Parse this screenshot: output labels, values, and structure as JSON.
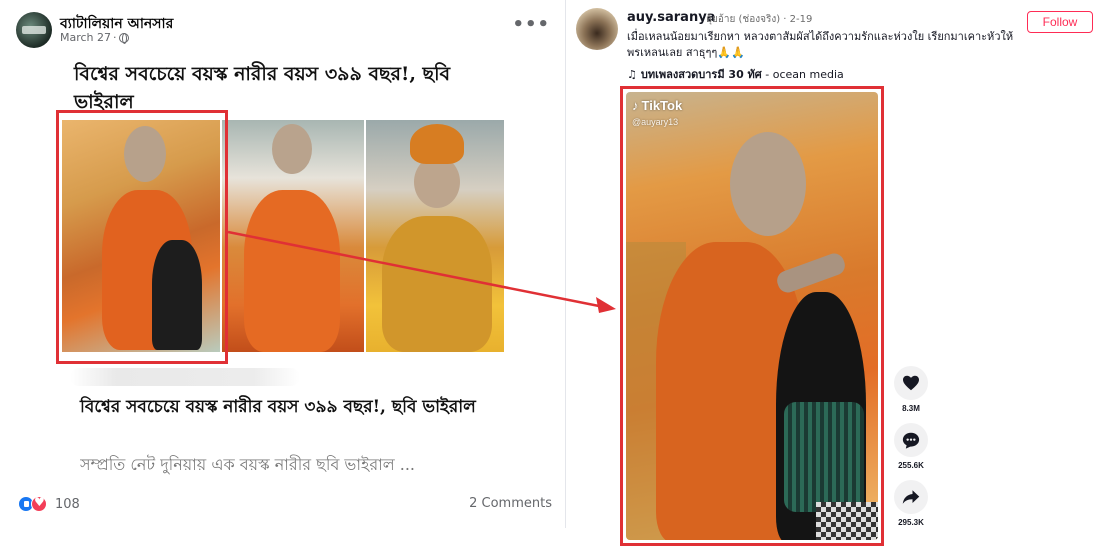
{
  "facebook_post": {
    "page_name": "ব্যাটালিয়ান আনসার",
    "date": "March 27",
    "more_label": "•••",
    "headline": "বিশ্বের সবচেয়ে বয়স্ক নারীর বয়স ৩৯৯ বছর!, ছবি ভাইরাল",
    "link_title": "বিশ্বের সবচেয়ে বয়স্ক নারীর বয়স ৩৯৯ বছর!, ছবি ভাইরাল",
    "link_description": "সম্প্রতি নেট দুনিয়ায় এক বয়স্ক নারীর ছবি ভাইরাল ...",
    "reaction_count": "108",
    "comment_count": "2 Comments",
    "icons": [
      "globe-icon",
      "like-reaction-icon",
      "love-reaction-icon",
      "more-options-icon"
    ]
  },
  "tiktok_post": {
    "username": "auy.saranya",
    "meta": "อุ้ยอ้าย (ช่องจริง) · 2-19",
    "follow_label": "Follow",
    "caption": "เมื่อเหลนน้อยมาเรียกหา หลวงตาสัมผัสได้ถึงความรักและห่วงใย เรียกมาเคาะหัวให้พรเหลนเลย สาธุๆๆ🙏🙏",
    "music_title": "บทเพลงสวดบารมี 30 ทัศ",
    "music_source": "ocean media",
    "watermark_logo": "TikTok",
    "watermark_handle": "@auyary13",
    "actions": [
      {
        "icon": "heart-icon",
        "count": "8.3M"
      },
      {
        "icon": "comment-icon",
        "count": "255.6K"
      },
      {
        "icon": "share-icon",
        "count": "295.3K"
      }
    ]
  },
  "colors": {
    "highlight_red": "#e03035",
    "facebook_blue": "#1877f2",
    "tiktok_red": "#fe2c55",
    "muted_text": "#65676b"
  }
}
